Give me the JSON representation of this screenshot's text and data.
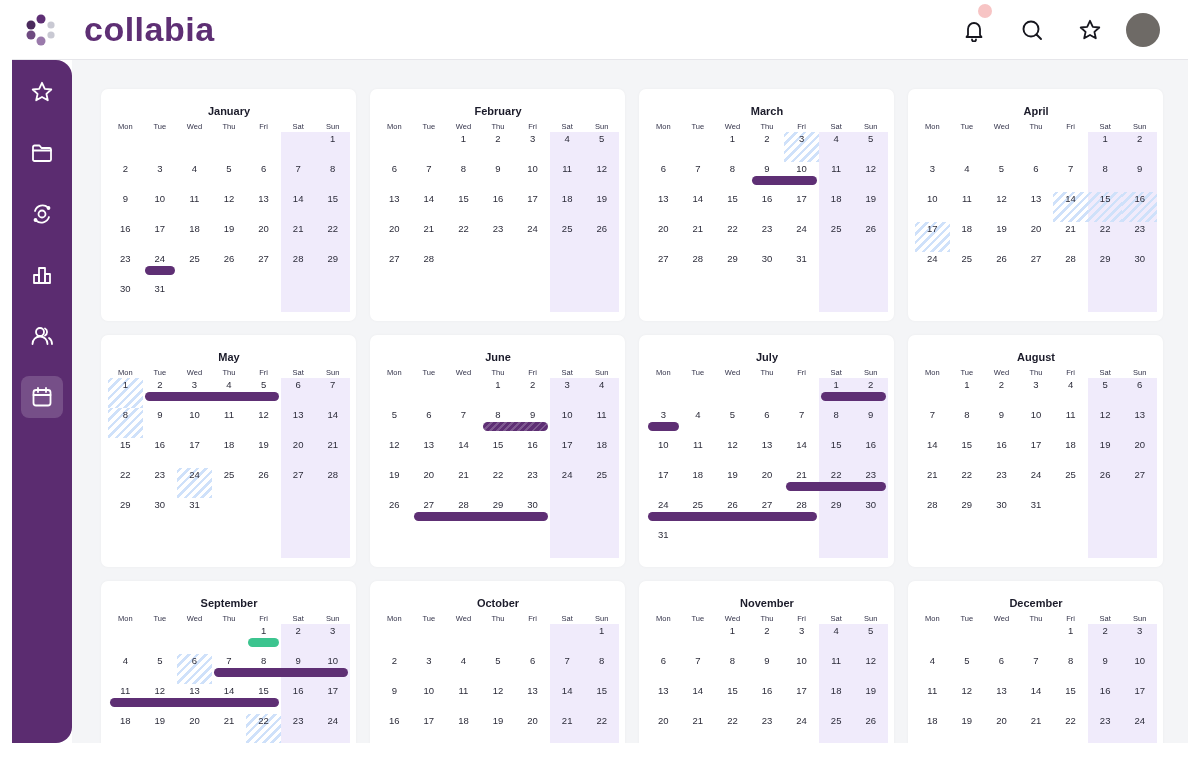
{
  "header": {
    "brand": "collabia",
    "notifications_unread": true
  },
  "sidebar": {
    "items": [
      {
        "selected": false
      },
      {
        "selected": false
      },
      {
        "selected": false
      },
      {
        "selected": false
      },
      {
        "selected": false
      },
      {
        "selected": true
      }
    ]
  },
  "months": [
    {
      "name": "January",
      "weekdays": [
        "Mon",
        "Tue",
        "Wed",
        "Thu",
        "Fri",
        "Sat",
        "Sun"
      ],
      "weeks": [
        {
          "sun": "1"
        },
        {
          "mon": "2",
          "tue": "3",
          "wed": "4",
          "thu": "5",
          "fri": "6",
          "sat": "7",
          "sun": "8"
        },
        {
          "mon": "9",
          "tue": "10",
          "wed": "11",
          "thu": "12",
          "fri": "13",
          "sat": "14",
          "sun": "15"
        },
        {
          "mon": "16",
          "tue": "17",
          "wed": "18",
          "thu": "19",
          "fri": "20",
          "sat": "21",
          "sun": "22"
        },
        {
          "mon": "23",
          "tue": {
            "day": "24",
            "event_start": true,
            "event_end": true,
            "color": "#5e2f74"
          },
          "wed": "25",
          "thu": "26",
          "fri": "27",
          "sat": "28",
          "sun": "29"
        },
        {
          "mon": "30",
          "tue": "31"
        }
      ]
    },
    {
      "name": "February",
      "weekdays": [
        "Mon",
        "Tue",
        "Wed",
        "Thu",
        "Fri",
        "Sat",
        "Sun"
      ],
      "weeks": [
        {
          "wed": "1",
          "thu": "2",
          "fri": "3",
          "sat": "4",
          "sun": "5"
        },
        {
          "mon": "6",
          "tue": "7",
          "wed": "8",
          "thu": "9",
          "fri": "10",
          "sat": "11",
          "sun": "12"
        },
        {
          "mon": "13",
          "tue": "14",
          "wed": "15",
          "thu": "16",
          "fri": "17",
          "sat": "18",
          "sun": "19"
        },
        {
          "mon": "20",
          "tue": "21",
          "wed": "22",
          "thu": "23",
          "fri": "24",
          "sat": "25",
          "sun": "26"
        },
        {
          "mon": "27",
          "tue": "28"
        }
      ]
    },
    {
      "name": "March",
      "weekdays": [
        "Mon",
        "Tue",
        "Wed",
        "Thu",
        "Fri",
        "Sat",
        "Sun"
      ],
      "weeks": [
        {
          "wed": "1",
          "thu": "2",
          "fri": {
            "day": "3",
            "hatched": true
          },
          "sat": "4",
          "sun": "5"
        },
        {
          "mon": "6",
          "tue": "7",
          "wed": "8",
          "thu": {
            "day": "9",
            "event_start": true,
            "color": "#5e2f74"
          },
          "fri": {
            "day": "10",
            "event_end": true
          },
          "sat": "11",
          "sun": "12"
        },
        {
          "mon": "13",
          "tue": "14",
          "wed": "15",
          "thu": "16",
          "fri": "17",
          "sat": "18",
          "sun": "19"
        },
        {
          "mon": "20",
          "tue": "21",
          "wed": "22",
          "thu": "23",
          "fri": "24",
          "sat": "25",
          "sun": "26"
        },
        {
          "mon": "27",
          "tue": "28",
          "wed": "29",
          "thu": "30",
          "fri": "31"
        }
      ]
    },
    {
      "name": "April",
      "weekdays": [
        "Mon",
        "Tue",
        "Wed",
        "Thu",
        "Fri",
        "Sat",
        "Sun"
      ],
      "weeks": [
        {
          "sat": "1",
          "sun": "2"
        },
        {
          "mon": "3",
          "tue": "4",
          "wed": "5",
          "thu": "6",
          "fri": "7",
          "sat": "8",
          "sun": "9"
        },
        {
          "mon": "10",
          "tue": "11",
          "wed": "12",
          "thu": "13",
          "fri": {
            "day": "14",
            "hatched": true
          },
          "sat": {
            "day": "15",
            "hatched": true
          },
          "sun": {
            "day": "16",
            "hatched": true
          }
        },
        {
          "mon": {
            "day": "17",
            "hatched": true
          },
          "tue": "18",
          "wed": "19",
          "thu": "20",
          "fri": "21",
          "sat": "22",
          "sun": "23"
        },
        {
          "mon": "24",
          "tue": "25",
          "wed": "26",
          "thu": "27",
          "fri": "28",
          "sat": "29",
          "sun": "30"
        }
      ]
    },
    {
      "name": "May",
      "weekdays": [
        "Mon",
        "Tue",
        "Wed",
        "Thu",
        "Fri",
        "Sat",
        "Sun"
      ],
      "weeks": [
        {
          "mon": {
            "day": "1",
            "hatched": true
          },
          "tue": {
            "day": "2",
            "event_start": true,
            "color": "#5e2f74"
          },
          "wed": "3",
          "thu": "4",
          "fri": {
            "day": "5",
            "event_end": true
          },
          "sat": "6",
          "sun": "7"
        },
        {
          "mon": {
            "day": "8",
            "hatched": true
          },
          "tue": "9",
          "wed": "10",
          "thu": "11",
          "fri": "12",
          "sat": "13",
          "sun": "14"
        },
        {
          "mon": "15",
          "tue": "16",
          "wed": "17",
          "thu": "18",
          "fri": "19",
          "sat": "20",
          "sun": "21"
        },
        {
          "mon": "22",
          "tue": "23",
          "wed": {
            "day": "24",
            "hatched": true
          },
          "thu": "25",
          "fri": "26",
          "sat": "27",
          "sun": "28"
        },
        {
          "mon": "29",
          "tue": "30",
          "wed": "31"
        }
      ]
    },
    {
      "name": "June",
      "weekdays": [
        "Mon",
        "Tue",
        "Wed",
        "Thu",
        "Fri",
        "Sat",
        "Sun"
      ],
      "weeks": [
        {
          "thu": "1",
          "fri": "2",
          "sat": "3",
          "sun": "4"
        },
        {
          "mon": "5",
          "tue": "6",
          "wed": "7",
          "thu": {
            "day": "8",
            "event_start": true,
            "color": "#5e2f74",
            "striped": true
          },
          "fri": {
            "day": "9",
            "event_end": true
          },
          "sat": "10",
          "sun": "11"
        },
        {
          "mon": "12",
          "tue": "13",
          "wed": "14",
          "thu": "15",
          "fri": "16",
          "sat": "17",
          "sun": "18"
        },
        {
          "mon": "19",
          "tue": "20",
          "wed": "21",
          "thu": "22",
          "fri": "23",
          "sat": "24",
          "sun": "25"
        },
        {
          "mon": "26",
          "tue": {
            "day": "27",
            "event_start": true,
            "color": "#5e2f74"
          },
          "wed": "28",
          "thu": "29",
          "fri": {
            "day": "30",
            "event_end": true
          }
        }
      ]
    },
    {
      "name": "July",
      "weekdays": [
        "Mon",
        "Tue",
        "Wed",
        "Thu",
        "Fri",
        "Sat",
        "Sun"
      ],
      "weeks": [
        {
          "sat": {
            "day": "1",
            "event_start": true,
            "color": "#5e2f74"
          },
          "sun": {
            "day": "2",
            "event_end": true
          }
        },
        {
          "mon": {
            "day": "3",
            "event_start": true,
            "event_end": true,
            "color": "#5e2f74"
          },
          "tue": "4",
          "wed": "5",
          "thu": "6",
          "fri": "7",
          "sat": "8",
          "sun": "9"
        },
        {
          "mon": "10",
          "tue": "11",
          "wed": "12",
          "thu": "13",
          "fri": "14",
          "sat": "15",
          "sun": "16"
        },
        {
          "mon": "17",
          "tue": "18",
          "wed": "19",
          "thu": "20",
          "fri": {
            "day": "21",
            "event_start": true,
            "color": "#5e2f74"
          },
          "sat": "22",
          "sun": {
            "day": "23",
            "event_end": true
          }
        },
        {
          "mon": {
            "day": "24",
            "event_start": true,
            "color": "#5e2f74"
          },
          "tue": "25",
          "wed": "26",
          "thu": "27",
          "fri": {
            "day": "28",
            "event_end": true
          },
          "sat": "29",
          "sun": "30"
        },
        {
          "mon": "31"
        }
      ]
    },
    {
      "name": "August",
      "weekdays": [
        "Mon",
        "Tue",
        "Wed",
        "Thu",
        "Fri",
        "Sat",
        "Sun"
      ],
      "weeks": [
        {
          "tue": "1",
          "wed": "2",
          "thu": "3",
          "fri": "4",
          "sat": "5",
          "sun": "6"
        },
        {
          "mon": "7",
          "tue": "8",
          "wed": "9",
          "thu": "10",
          "fri": "11",
          "sat": "12",
          "sun": "13"
        },
        {
          "mon": "14",
          "tue": "15",
          "wed": "16",
          "thu": "17",
          "fri": "18",
          "sat": "19",
          "sun": "20"
        },
        {
          "mon": "21",
          "tue": "22",
          "wed": "23",
          "thu": "24",
          "fri": "25",
          "sat": "26",
          "sun": "27"
        },
        {
          "mon": "28",
          "tue": "29",
          "wed": "30",
          "thu": "31"
        }
      ]
    },
    {
      "name": "September",
      "weekdays": [
        "Mon",
        "Tue",
        "Wed",
        "Thu",
        "Fri",
        "Sat",
        "Sun"
      ],
      "weeks": [
        {
          "fri": {
            "day": "1",
            "event_start": true,
            "event_end": true,
            "color": "#3cc48f"
          },
          "sat": "2",
          "sun": "3"
        },
        {
          "mon": "4",
          "tue": "5",
          "wed": {
            "day": "6",
            "hatched": true
          },
          "thu": {
            "day": "7",
            "event_start": true,
            "color": "#5e2f74"
          },
          "fri": "8",
          "sat": "9",
          "sun": {
            "day": "10",
            "event_end": true
          }
        },
        {
          "mon": {
            "day": "11",
            "event_start": true,
            "color": "#5e2f74"
          },
          "tue": "12",
          "wed": "13",
          "thu": "14",
          "fri": {
            "day": "15",
            "event_end": true
          },
          "sat": "16",
          "sun": "17"
        },
        {
          "mon": "18",
          "tue": "19",
          "wed": "20",
          "thu": "21",
          "fri": {
            "day": "22",
            "hatched": true
          },
          "sat": "23",
          "sun": "24"
        }
      ]
    },
    {
      "name": "October",
      "weekdays": [
        "Mon",
        "Tue",
        "Wed",
        "Thu",
        "Fri",
        "Sat",
        "Sun"
      ],
      "weeks": [
        {
          "sun": "1"
        },
        {
          "mon": "2",
          "tue": "3",
          "wed": "4",
          "thu": "5",
          "fri": "6",
          "sat": "7",
          "sun": "8"
        },
        {
          "mon": "9",
          "tue": "10",
          "wed": "11",
          "thu": "12",
          "fri": "13",
          "sat": "14",
          "sun": "15"
        },
        {
          "mon": "16",
          "tue": "17",
          "wed": "18",
          "thu": "19",
          "fri": "20",
          "sat": "21",
          "sun": "22"
        }
      ]
    },
    {
      "name": "November",
      "weekdays": [
        "Mon",
        "Tue",
        "Wed",
        "Thu",
        "Fri",
        "Sat",
        "Sun"
      ],
      "weeks": [
        {
          "wed": "1",
          "thu": "2",
          "fri": "3",
          "sat": "4",
          "sun": "5"
        },
        {
          "mon": "6",
          "tue": "7",
          "wed": "8",
          "thu": "9",
          "fri": "10",
          "sat": "11",
          "sun": "12"
        },
        {
          "mon": "13",
          "tue": "14",
          "wed": "15",
          "thu": "16",
          "fri": "17",
          "sat": "18",
          "sun": "19"
        },
        {
          "mon": "20",
          "tue": "21",
          "wed": "22",
          "thu": "23",
          "fri": "24",
          "sat": "25",
          "sun": "26"
        }
      ]
    },
    {
      "name": "December",
      "weekdays": [
        "Mon",
        "Tue",
        "Wed",
        "Thu",
        "Fri",
        "Sat",
        "Sun"
      ],
      "weeks": [
        {
          "fri": "1",
          "sat": "2",
          "sun": "3"
        },
        {
          "mon": "4",
          "tue": "5",
          "wed": "6",
          "thu": "7",
          "fri": "8",
          "sat": "9",
          "sun": "10"
        },
        {
          "mon": "11",
          "tue": "12",
          "wed": "13",
          "thu": "14",
          "fri": "15",
          "sat": "16",
          "sun": "17"
        },
        {
          "mon": "18",
          "tue": "19",
          "wed": "20",
          "thu": "21",
          "fri": "22",
          "sat": "23",
          "sun": "24"
        }
      ]
    }
  ]
}
